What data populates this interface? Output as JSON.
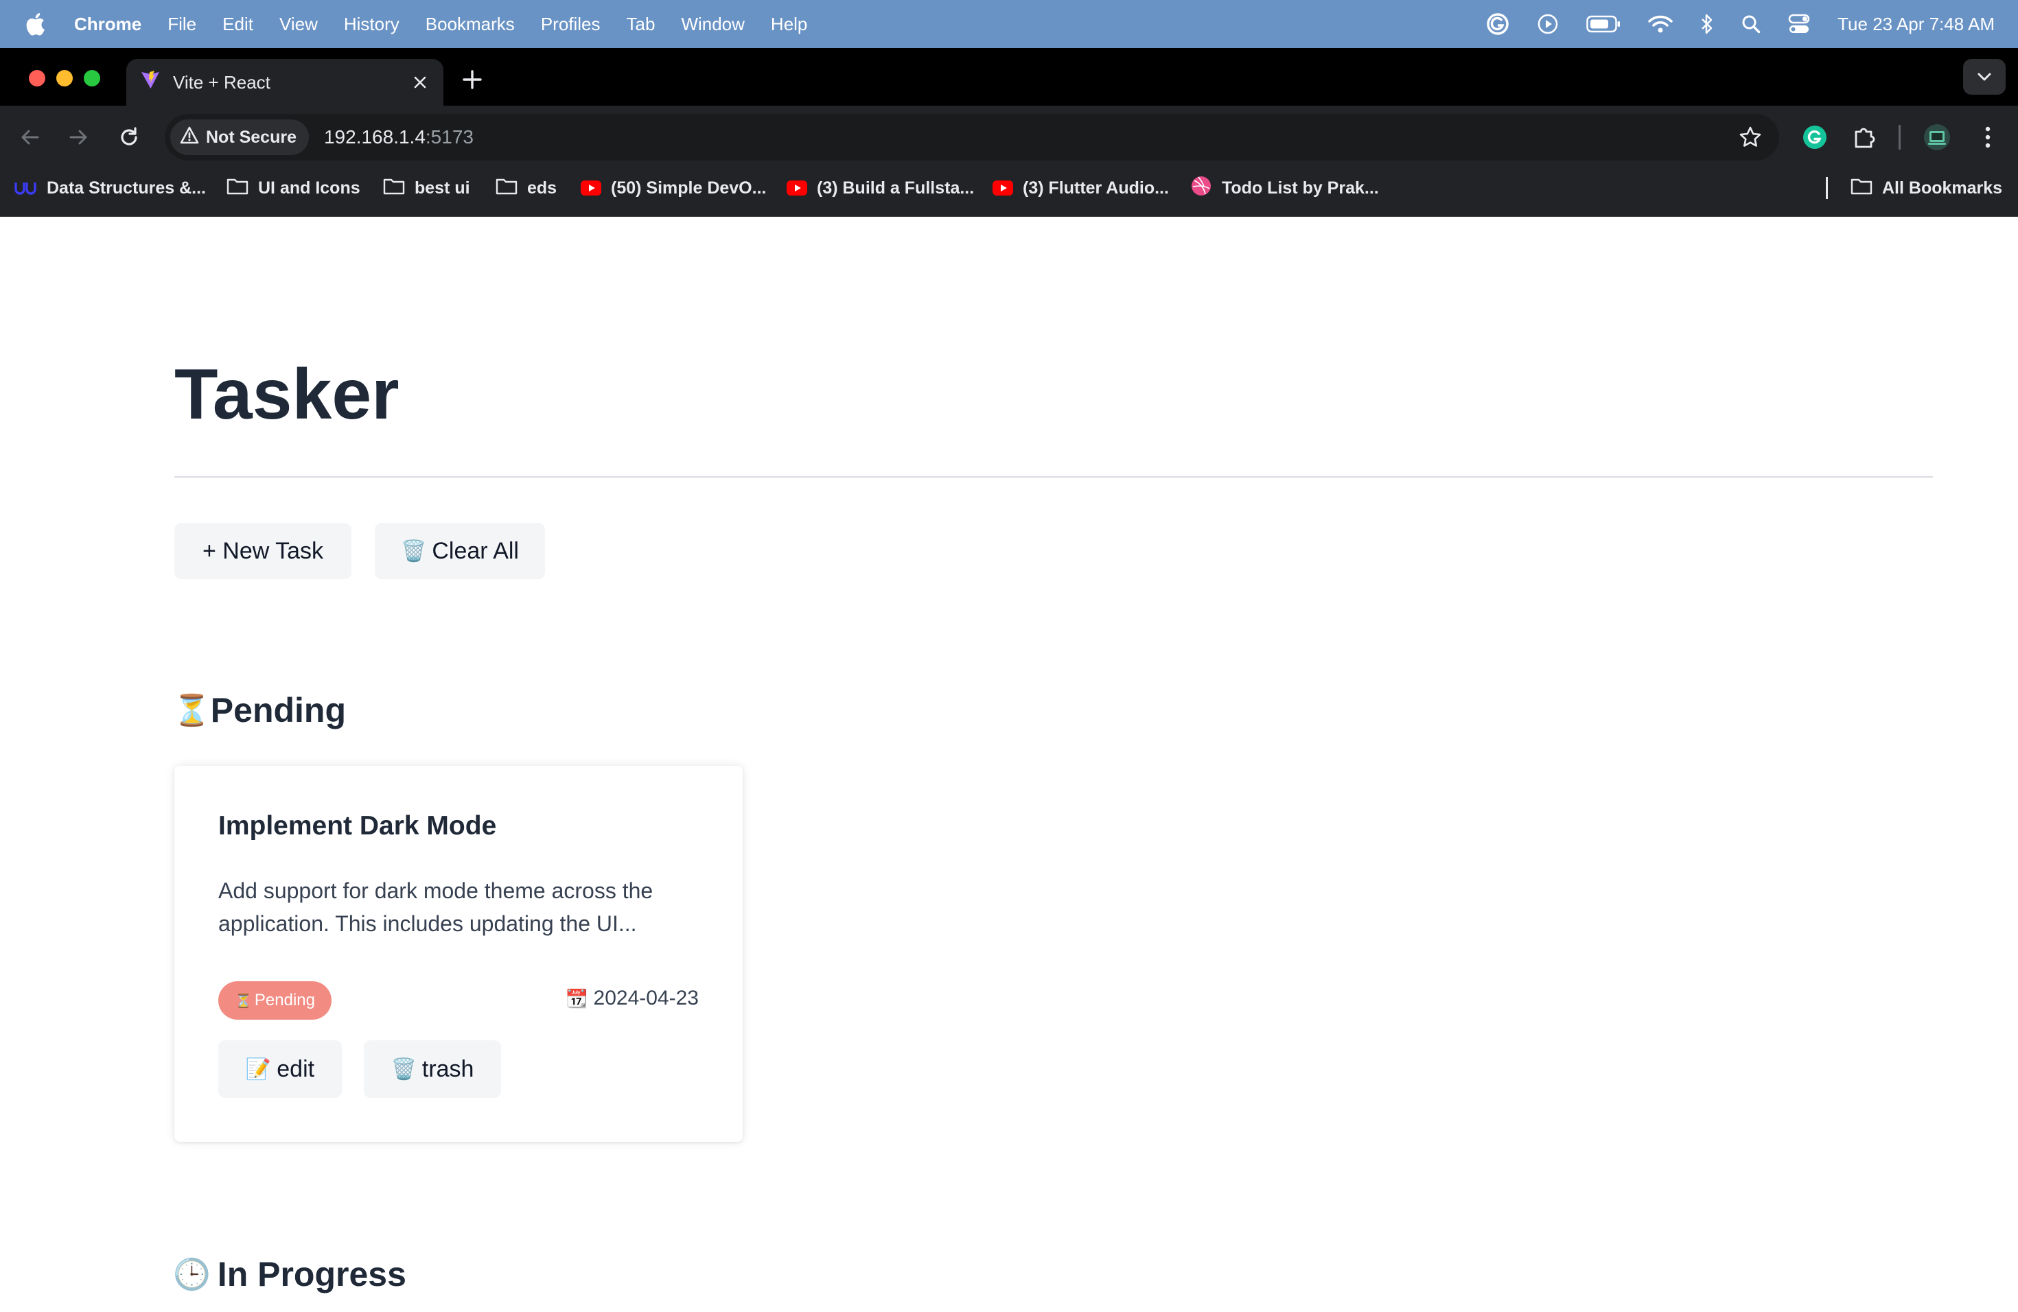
{
  "menubar": {
    "app_name": "Chrome",
    "items": [
      "File",
      "Edit",
      "View",
      "History",
      "Bookmarks",
      "Profiles",
      "Tab",
      "Window",
      "Help"
    ],
    "clock": "Tue 23 Apr  7:48 AM"
  },
  "browser": {
    "tab_title": "Vite + React",
    "security_label": "Not Secure",
    "url_host": "192.168.1.4",
    "url_port": ":5173",
    "bookmarks": [
      {
        "label": "Data Structures &...",
        "icon": "udemy-icon"
      },
      {
        "label": "UI and Icons",
        "icon": "folder-icon"
      },
      {
        "label": "best ui",
        "icon": "folder-icon"
      },
      {
        "label": "eds",
        "icon": "folder-icon"
      },
      {
        "label": "(50) Simple DevO...",
        "icon": "youtube-icon"
      },
      {
        "label": "(3) Build a Fullsta...",
        "icon": "youtube-icon"
      },
      {
        "label": "(3) Flutter Audio...",
        "icon": "youtube-icon"
      },
      {
        "label": "Todo List by Prak...",
        "icon": "dribbble-icon"
      }
    ],
    "all_bookmarks": "All Bookmarks"
  },
  "app": {
    "title": "Tasker",
    "new_task_label": "+ New Task",
    "clear_all_label": "Clear All",
    "clear_all_icon": "🗑️",
    "sections": {
      "pending": {
        "icon": "⏳",
        "label": "Pending"
      },
      "in_progress": {
        "icon": "🕒",
        "label": "In Progress"
      }
    },
    "tasks": [
      {
        "title": "Implement Dark Mode",
        "description": "Add support for dark mode theme across the application. This includes updating the UI...",
        "status_icon": "⏳",
        "status": "Pending",
        "date_icon": "📆",
        "due_date": "2024-04-23",
        "edit_icon": "📝",
        "edit_label": "edit",
        "trash_icon": "🗑️",
        "trash_label": "trash"
      }
    ]
  },
  "colors": {
    "menubar": "#6a93c5",
    "badge_pending": "#f28b82",
    "title_text": "#1f2937",
    "button_bg": "#f4f5f7"
  }
}
